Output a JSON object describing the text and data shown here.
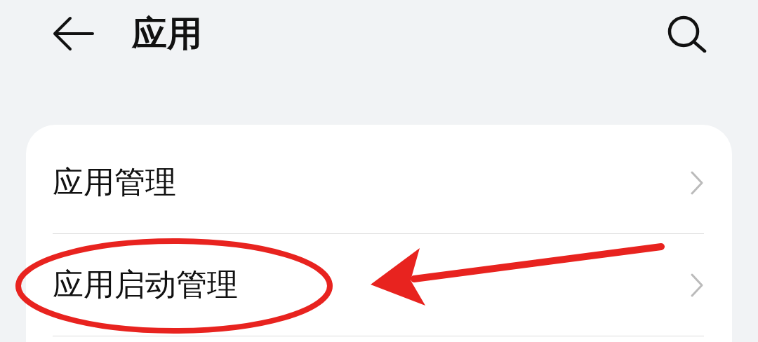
{
  "header": {
    "title": "应用"
  },
  "items": [
    {
      "label": "应用管理"
    },
    {
      "label": "应用启动管理"
    }
  ]
}
